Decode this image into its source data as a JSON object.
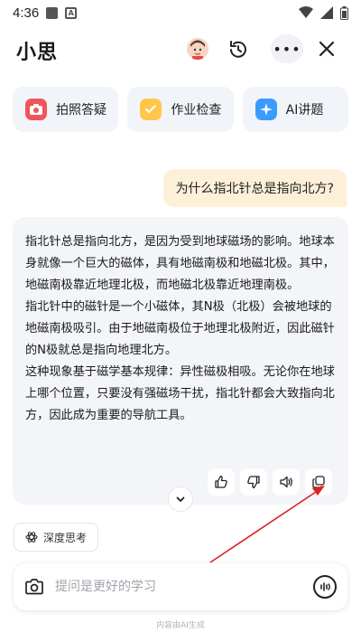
{
  "status_bar": {
    "time": "4:36"
  },
  "header": {
    "title": "小思"
  },
  "quick_actions": [
    {
      "label": "拍照答疑",
      "icon": "camera-icon"
    },
    {
      "label": "作业检查",
      "icon": "homework-check-icon"
    },
    {
      "label": "AI讲题",
      "icon": "ai-spark-icon"
    }
  ],
  "conversation": {
    "user_question": "为什么指北针总是指向北方?",
    "answer_paragraphs": [
      "指北针总是指向北方，是因为受到地球磁场的影响。地球本身就像一个巨大的磁体，具有地磁南极和地磁北极。其中，地磁南极靠近地理北极，而地磁北极靠近地理南极。",
      "指北针中的磁针是一个小磁体，其N极（北极）会被地球的地磁南极吸引。由于地磁南极位于地理北极附近，因此磁针的N极就总是指向地理北方。",
      "这种现象基于磁学基本规律：异性磁极相吸。无论你在地球上哪个位置，只要没有强磁场干扰，指北针都会大致指向北方，因此成为重要的导航工具。"
    ]
  },
  "deep_think": {
    "label": "深度思考"
  },
  "input": {
    "placeholder": "提问是更好的学习"
  },
  "footer": {
    "note": "内容由AI生成"
  },
  "colors": {
    "user_bubble": "#fdf0d9",
    "answer_card": "#f3f5f8",
    "annotation_arrow": "#e02020"
  }
}
